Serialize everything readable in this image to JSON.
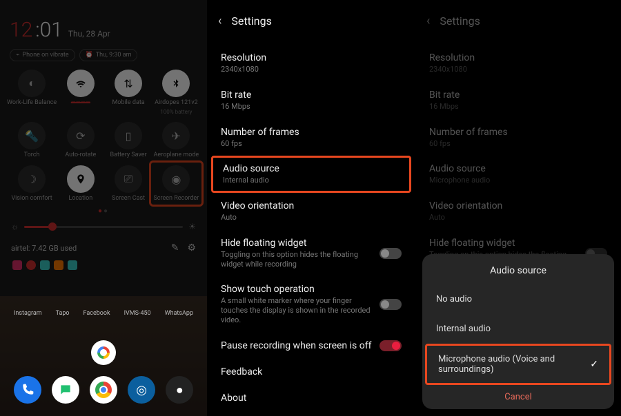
{
  "accent": "#d32f2f",
  "qs": {
    "hour": "12",
    "colon": ":",
    "min": "01",
    "date": "Thu, 28 Apr",
    "chips": [
      "Phone on vibrate",
      "Thu, 9:30 am"
    ],
    "tiles": [
      {
        "icon": "do-not-disturb-icon",
        "label": "Work-Life Balance",
        "sub": "",
        "on": false
      },
      {
        "icon": "wifi-icon",
        "label": "————",
        "sub": "",
        "on": true
      },
      {
        "icon": "mobile-data-icon",
        "label": "Mobile data",
        "sub": "",
        "on": true
      },
      {
        "icon": "bluetooth-icon",
        "label": "Airdopes 121v2",
        "sub": "100% battery",
        "on": true
      },
      {
        "icon": "torch-icon",
        "label": "Torch",
        "sub": "",
        "on": false
      },
      {
        "icon": "auto-rotate-icon",
        "label": "Auto-rotate",
        "sub": "",
        "on": false
      },
      {
        "icon": "battery-saver-icon",
        "label": "Battery Saver",
        "sub": "",
        "on": false
      },
      {
        "icon": "airplane-icon",
        "label": "Aeroplane mode",
        "sub": "",
        "on": false
      },
      {
        "icon": "vision-comfort-icon",
        "label": "Vision comfort",
        "sub": "",
        "on": false
      },
      {
        "icon": "location-icon",
        "label": "Location",
        "sub": "",
        "on": true
      },
      {
        "icon": "cast-icon",
        "label": "Screen Cast",
        "sub": "",
        "on": false
      },
      {
        "icon": "record-icon",
        "label": "Screen Recorder",
        "sub": "",
        "on": false
      }
    ],
    "usage": "airtel: 7.42 GB used",
    "home_apps": [
      "Instagram",
      "Tapo",
      "Facebook",
      "IVMS-450",
      "WhatsApp"
    ]
  },
  "settings": {
    "title": "Settings",
    "items": [
      {
        "t": "Resolution",
        "s": "2340x1080"
      },
      {
        "t": "Bit rate",
        "s": "16 Mbps"
      },
      {
        "t": "Number of frames",
        "s": "60 fps"
      },
      {
        "t": "Audio source",
        "s": "Internal audio"
      },
      {
        "t": "Video orientation",
        "s": "Auto"
      },
      {
        "t": "Hide floating widget",
        "s": "Toggling on this option hides the floating widget while recording",
        "toggle": false
      },
      {
        "t": "Show touch operation",
        "s": "A small white marker where your finger touches the display is shown in the recorded video.",
        "toggle": false
      },
      {
        "t": "Pause recording when screen is off",
        "s": "",
        "toggle": true
      },
      {
        "t": "Feedback",
        "s": ""
      },
      {
        "t": "About",
        "s": ""
      }
    ]
  },
  "settings3": {
    "audio_sub": "Microphone audio"
  },
  "dialog": {
    "title": "Audio source",
    "opts": [
      "No audio",
      "Internal audio",
      "Microphone audio (Voice and surroundings)"
    ],
    "cancel": "Cancel"
  }
}
